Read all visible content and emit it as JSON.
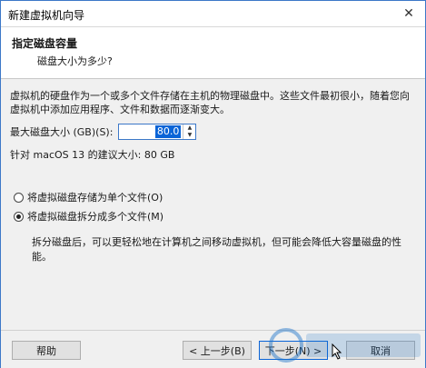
{
  "window": {
    "title": "新建虚拟机向导",
    "close_glyph": "✕"
  },
  "header": {
    "title": "指定磁盘容量",
    "subtitle": "磁盘大小为多少?"
  },
  "body": {
    "description": "虚拟机的硬盘作为一个或多个文件存储在主机的物理磁盘中。这些文件最初很小，随着您向虚拟机中添加应用程序、文件和数据而逐渐变大。",
    "size_label": "最大磁盘大小 (GB)(S):",
    "size_value": "80.0",
    "recommended": "针对 macOS 13 的建议大小: 80 GB",
    "option_single": "将虚拟磁盘存储为单个文件(O)",
    "option_multi": "将虚拟磁盘拆分成多个文件(M)",
    "multi_note": "拆分磁盘后，可以更轻松地在计算机之间移动虚拟机，但可能会降低大容量磁盘的性能。",
    "selected_option": "multi"
  },
  "footer": {
    "help": "帮助",
    "back": "< 上一步(B)",
    "next": "下一步(N) >",
    "cancel": "取消"
  }
}
